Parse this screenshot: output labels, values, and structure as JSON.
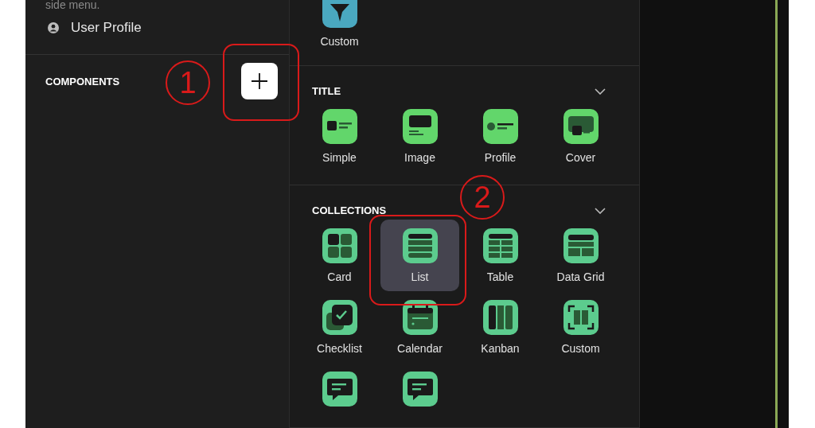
{
  "sidebar": {
    "description": "side menu.",
    "items": [
      {
        "label": "User Profile"
      }
    ],
    "section_title": "COMPONENTS"
  },
  "panel": {
    "sections": [
      {
        "items": [
          {
            "kind": "custom-star",
            "label": "Custom",
            "color": "#4aa8c0",
            "selected": false
          }
        ]
      },
      {
        "title": "TITLE",
        "expanded": true,
        "items": [
          {
            "kind": "simple",
            "label": "Simple",
            "color": "#62d66b",
            "selected": false
          },
          {
            "kind": "image",
            "label": "Image",
            "color": "#62d66b",
            "selected": false
          },
          {
            "kind": "profile",
            "label": "Profile",
            "color": "#62d66b",
            "selected": false
          },
          {
            "kind": "cover",
            "label": "Cover",
            "color": "#62d66b",
            "selected": false
          }
        ]
      },
      {
        "title": "COLLECTIONS",
        "expanded": true,
        "items": [
          {
            "kind": "card",
            "label": "Card",
            "color": "#5ccc8e",
            "selected": false
          },
          {
            "kind": "list",
            "label": "List",
            "color": "#5ccc8e",
            "selected": true
          },
          {
            "kind": "table",
            "label": "Table",
            "color": "#5ccc8e",
            "selected": false
          },
          {
            "kind": "grid",
            "label": "Data Grid",
            "color": "#5ccc8e",
            "selected": false
          },
          {
            "kind": "checklist",
            "label": "Checklist",
            "color": "#5ccc8e",
            "selected": false
          },
          {
            "kind": "calendar",
            "label": "Calendar",
            "color": "#5ccc8e",
            "selected": false
          },
          {
            "kind": "kanban",
            "label": "Kanban",
            "color": "#5ccc8e",
            "selected": false
          },
          {
            "kind": "frame",
            "label": "Custom",
            "color": "#5ccc8e",
            "selected": false
          },
          {
            "kind": "chat",
            "color": "#5ccc8e",
            "selected": false
          },
          {
            "kind": "chat",
            "color": "#5ccc8e",
            "selected": false
          }
        ]
      }
    ]
  },
  "annotations": [
    {
      "label": "1"
    },
    {
      "label": "2"
    }
  ]
}
